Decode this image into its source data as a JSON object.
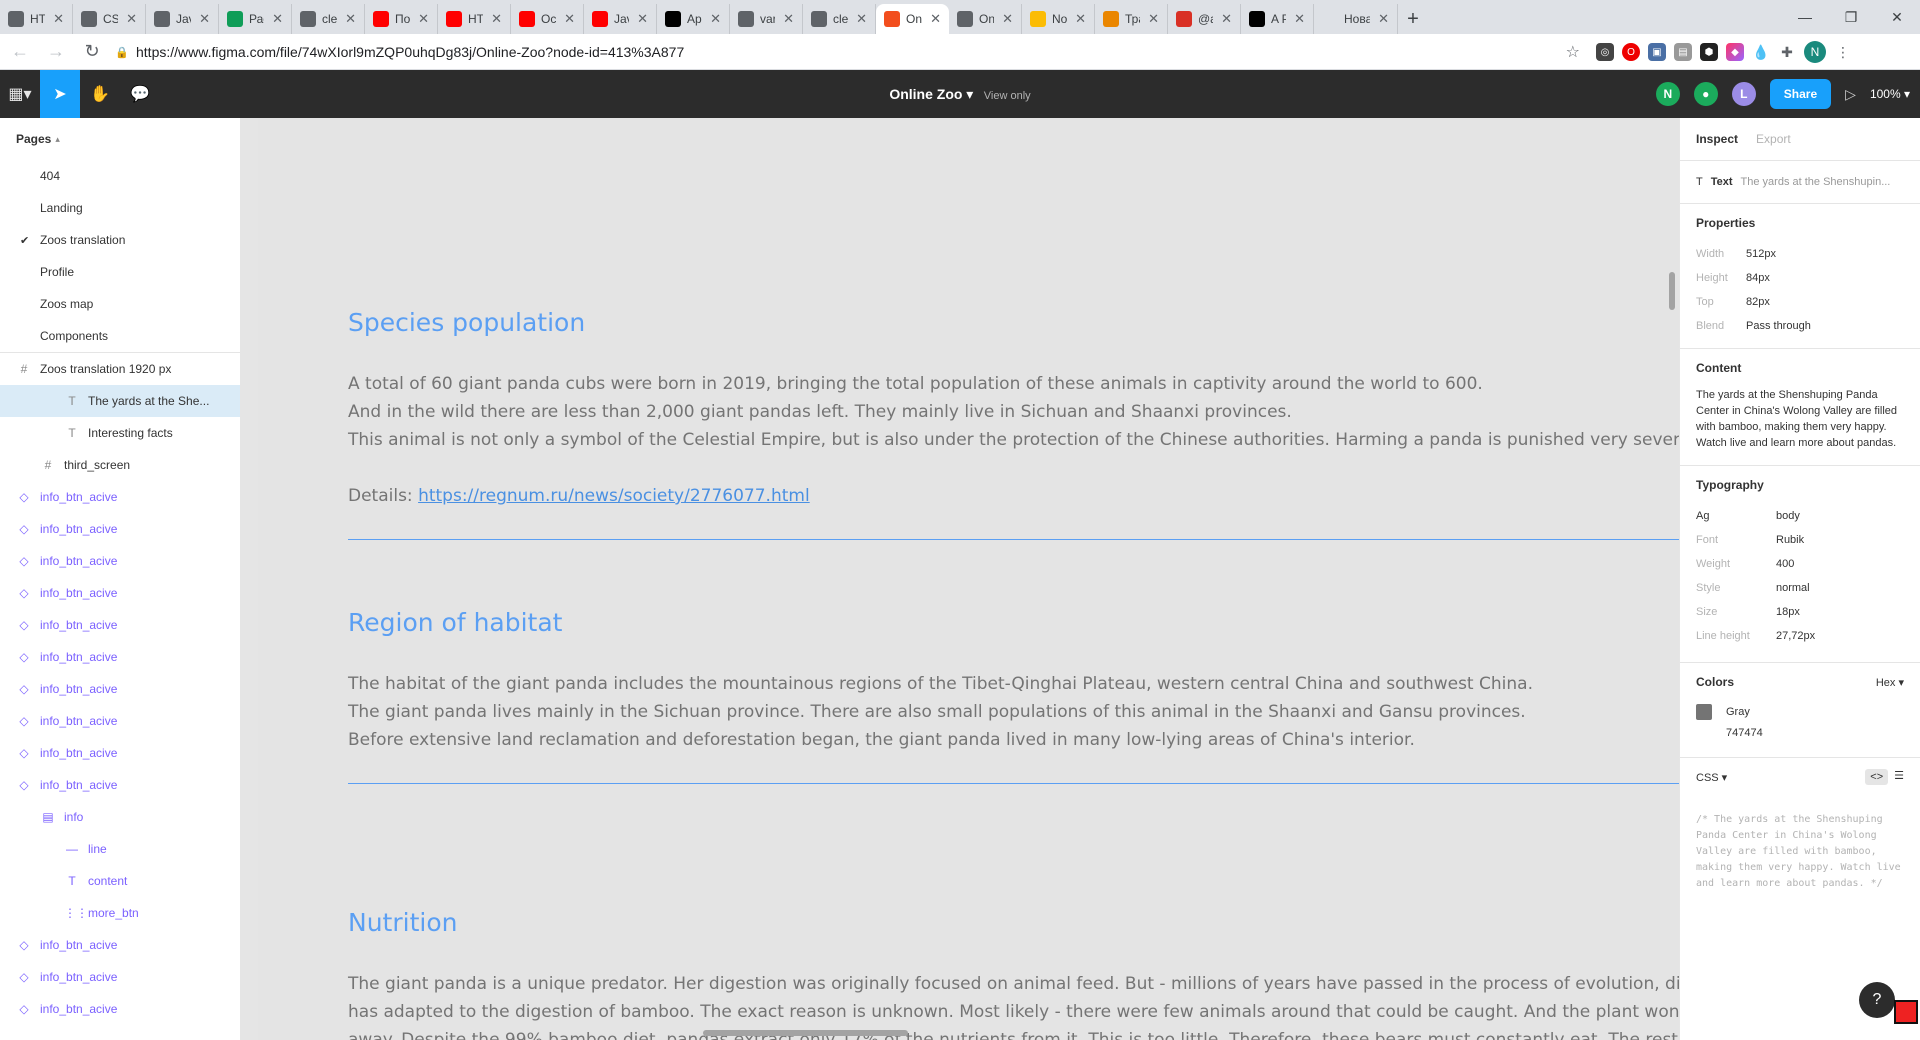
{
  "browser": {
    "tabs": [
      {
        "label": "HTM",
        "icon": "globe-icon",
        "color": "#5f6368"
      },
      {
        "label": "CSS",
        "icon": "globe-icon",
        "color": "#5f6368"
      },
      {
        "label": "Java",
        "icon": "globe-icon",
        "color": "#5f6368"
      },
      {
        "label": "Расп",
        "icon": "sheets-icon",
        "color": "#0f9d58"
      },
      {
        "label": "clea",
        "icon": "globe-icon",
        "color": "#5f6368"
      },
      {
        "label": "Подк",
        "icon": "youtube-icon",
        "color": "#ff0000"
      },
      {
        "label": "HTM",
        "icon": "youtube-icon",
        "color": "#ff0000"
      },
      {
        "label": "Осно",
        "icon": "youtube-icon",
        "color": "#ff0000"
      },
      {
        "label": "Java",
        "icon": "youtube-icon",
        "color": "#ff0000"
      },
      {
        "label": "App",
        "icon": "rs-icon",
        "color": "#000000"
      },
      {
        "label": "varia",
        "icon": "globe-icon",
        "color": "#5f6368"
      },
      {
        "label": "clea",
        "icon": "globe-icon",
        "color": "#5f6368"
      },
      {
        "label": "Onli",
        "icon": "figma-icon",
        "color": "#f24e1e",
        "active": true
      },
      {
        "label": "Onli",
        "icon": "globe-icon",
        "color": "#5f6368"
      },
      {
        "label": "Note",
        "icon": "note-icon",
        "color": "#fbbc04"
      },
      {
        "label": "Тран",
        "icon": "translate-icon",
        "color": "#ea8600"
      },
      {
        "label": "@an",
        "icon": "mail-icon",
        "color": "#d93025"
      },
      {
        "label": "A Pe",
        "icon": "openai-icon",
        "color": "#000000"
      },
      {
        "label": "Новая вк",
        "icon": "",
        "color": "#5f6368"
      }
    ],
    "url": "https://www.figma.com/file/74wXIorl9mZQP0uhqDg83j/Online-Zoo?node-id=413%3A877"
  },
  "toolbar": {
    "file_name": "Online Zoo",
    "view_only": "View only",
    "avatars": [
      {
        "letter": "N",
        "color": "#1bab5c"
      },
      {
        "letter": "",
        "color": "#1bab5c"
      },
      {
        "letter": "L",
        "color": "#9b8ce6"
      }
    ],
    "share_label": "Share",
    "zoom": "100%"
  },
  "left_panel": {
    "pages_label": "Pages",
    "pages": [
      {
        "label": "404"
      },
      {
        "label": "Landing"
      },
      {
        "label": "Zoos translation",
        "current": true
      },
      {
        "label": "Profile"
      },
      {
        "label": "Zoos map"
      },
      {
        "label": "Components"
      }
    ],
    "layers": [
      {
        "label": "Zoos translation 1920 px",
        "type": "frame",
        "indent": 0
      },
      {
        "label": "The yards at the She...",
        "type": "text",
        "indent": 2,
        "selected": true
      },
      {
        "label": "Interesting facts",
        "type": "text",
        "indent": 2
      },
      {
        "label": "third_screen",
        "type": "frame",
        "indent": 1
      },
      {
        "label": "info_btn_acive",
        "type": "instance",
        "indent": 0
      },
      {
        "label": "info_btn_acive",
        "type": "instance",
        "indent": 0
      },
      {
        "label": "info_btn_acive",
        "type": "instance",
        "indent": 0
      },
      {
        "label": "info_btn_acive",
        "type": "instance",
        "indent": 0
      },
      {
        "label": "info_btn_acive",
        "type": "instance",
        "indent": 0
      },
      {
        "label": "info_btn_acive",
        "type": "instance",
        "indent": 0
      },
      {
        "label": "info_btn_acive",
        "type": "instance",
        "indent": 0
      },
      {
        "label": "info_btn_acive",
        "type": "instance",
        "indent": 0
      },
      {
        "label": "info_btn_acive",
        "type": "instance",
        "indent": 0
      },
      {
        "label": "info_btn_acive",
        "type": "instance",
        "indent": 0
      },
      {
        "label": "info",
        "type": "group",
        "indent": 1
      },
      {
        "label": "line",
        "type": "line",
        "indent": 2
      },
      {
        "label": "content",
        "type": "text",
        "indent": 2
      },
      {
        "label": "more_btn",
        "type": "grid",
        "indent": 2
      },
      {
        "label": "info_btn_acive",
        "type": "instance",
        "indent": 0
      },
      {
        "label": "info_btn_acive",
        "type": "instance",
        "indent": 0
      },
      {
        "label": "info_btn_acive",
        "type": "instance",
        "indent": 0
      }
    ]
  },
  "canvas": {
    "sections": [
      {
        "title": "Species population",
        "paragraphs": [
          "A total of 60 giant panda cubs were born in 2019, bringing the total population of these animals in captivity around the world to 600.",
          "And in the wild there are less than 2,000 giant pandas left. They mainly live in Sichuan and Shaanxi provinces.",
          "This animal is not only a symbol of the Celestial Empire, but is also under the protection of the Chinese authorities. Harming a panda is punished very severely."
        ],
        "details_label": "Details:",
        "details_link": "https://regnum.ru/news/society/2776077.html"
      },
      {
        "title": "Region of habitat",
        "paragraphs": [
          "The habitat of the giant panda includes the mountainous regions of the Tibet-Qinghai Plateau, western central China and southwest China.",
          "The giant panda lives mainly in the Sichuan province. There are also small populations of this animal in the Shaanxi and Gansu provinces.",
          "Before extensive land reclamation and deforestation began, the giant panda lived in many low-lying areas of China's interior."
        ]
      },
      {
        "title": "Nutrition",
        "paragraphs": [
          "The giant panda is a unique predator. Her digestion was originally focused on animal feed. But - millions of years have passed in the process of evolution, digesti",
          "has adapted to the digestion of bamboo. The exact reason is unknown. Most likely - there were few animals around that could be caught. And the plant won't run",
          "away. Despite the 99% bamboo diet, pandas extract only 17% of the nutrients from it. This is too little. Therefore, these bears must constantly eat. The rest of the"
        ]
      }
    ],
    "title_color": "#5b9ff3",
    "text_color": "#747474"
  },
  "right_panel": {
    "tab_inspect": "Inspect",
    "tab_export": "Export",
    "layer_type": "Text",
    "layer_name": "The yards at the Shenshupin...",
    "properties_label": "Properties",
    "properties": [
      {
        "key": "Width",
        "value": "512px"
      },
      {
        "key": "Height",
        "value": "84px"
      },
      {
        "key": "Top",
        "value": "82px"
      },
      {
        "key": "Blend",
        "value": "Pass through"
      }
    ],
    "content_label": "Content",
    "content_text": "The yards at the Shenshuping Panda Center in China's Wolong Valley are filled with bamboo, making them very happy. Watch live and learn more about pandas.",
    "typography_label": "Typography",
    "typography": [
      {
        "key": "Ag",
        "value": "body"
      },
      {
        "key": "Font",
        "value": "Rubik"
      },
      {
        "key": "Weight",
        "value": "400"
      },
      {
        "key": "Style",
        "value": "normal"
      },
      {
        "key": "Size",
        "value": "18px"
      },
      {
        "key": "Line height",
        "value": "27,72px"
      }
    ],
    "colors_label": "Colors",
    "color_format": "Hex",
    "color_name": "Gray",
    "color_hex": "747474",
    "css_label": "CSS",
    "css_comment": "/* The yards at the Shenshuping Panda Center in China's Wolong Valley are filled with bamboo, making them very happy. Watch live and learn more about pandas. */"
  }
}
